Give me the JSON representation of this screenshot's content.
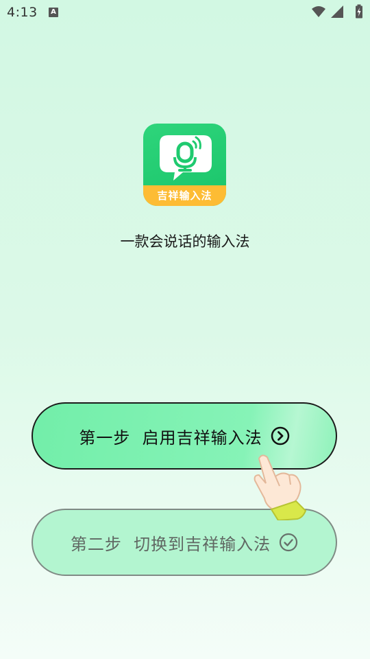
{
  "status_bar": {
    "time": "4:13",
    "notification_icon_letter": "A",
    "icons": [
      "wifi-icon",
      "cellular-signal-icon",
      "battery-icon"
    ]
  },
  "app": {
    "logo_banner_text": "吉祥输入法",
    "tagline": "一款会说话的输入法",
    "brand_green": "#1fca6f",
    "banner_yellow": "#fdbc34"
  },
  "steps": [
    {
      "label": "第一步  启用吉祥输入法",
      "icon": "chevron-right-circle-icon",
      "state": "active"
    },
    {
      "label": "第二步  切换到吉祥输入法",
      "icon": "check-circle-icon",
      "state": "pending"
    }
  ]
}
